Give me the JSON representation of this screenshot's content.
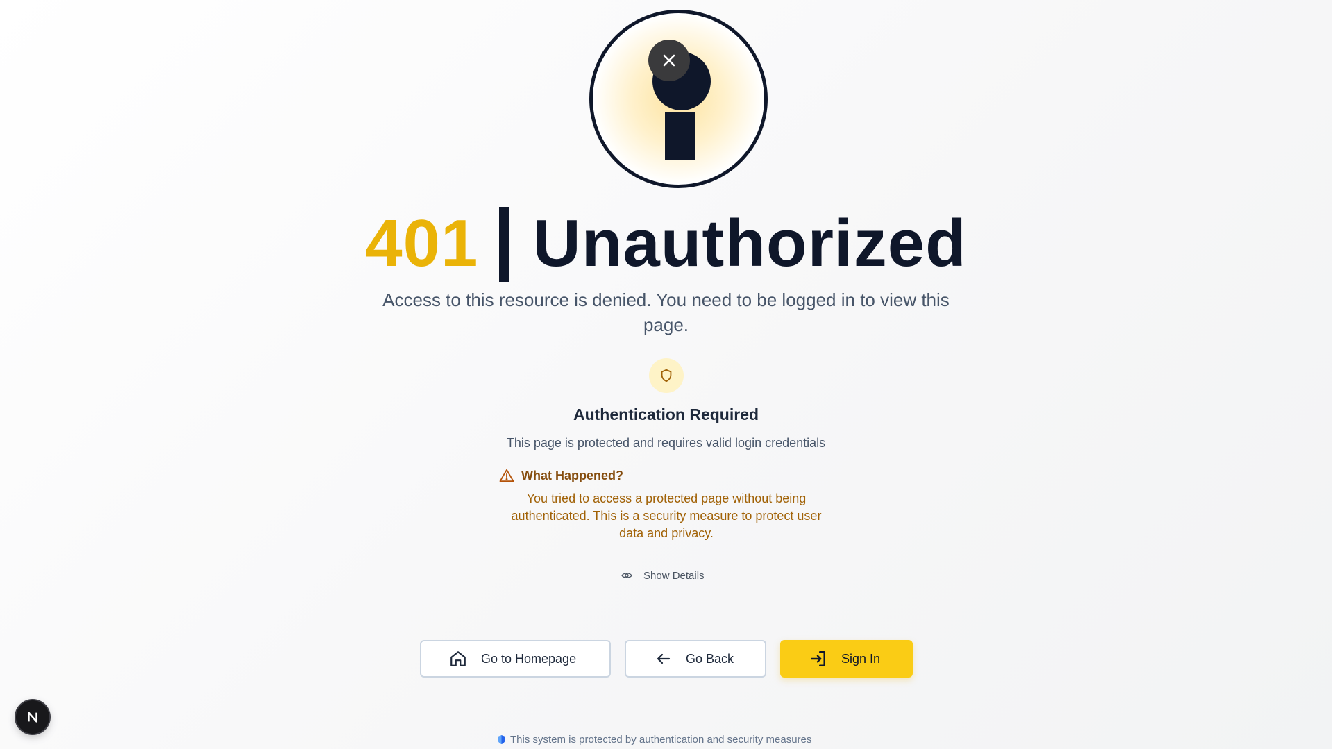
{
  "error": {
    "code": "401",
    "title": "Unauthorized",
    "message": "Access to this resource is denied. You need to be logged in to view this page."
  },
  "auth": {
    "icon": "shield-icon",
    "heading": "Authentication Required",
    "description": "This page is protected and requires valid login credentials"
  },
  "what_happened": {
    "heading": "What Happened?",
    "text": "You tried to access a protected page without being authenticated. This is a security measure to protect user data and privacy."
  },
  "details": {
    "toggle_label": "Show Details"
  },
  "actions": {
    "home_label": "Go to Homepage",
    "back_label": "Go Back",
    "signin_label": "Sign In"
  },
  "footer": {
    "text": "This system is protected by authentication and security measures"
  },
  "dev_badge": {
    "label": "N"
  },
  "colors": {
    "accent": "#eab308",
    "button_primary": "#facc15",
    "text_dark": "#0f172a",
    "warning_text": "#a16207"
  }
}
